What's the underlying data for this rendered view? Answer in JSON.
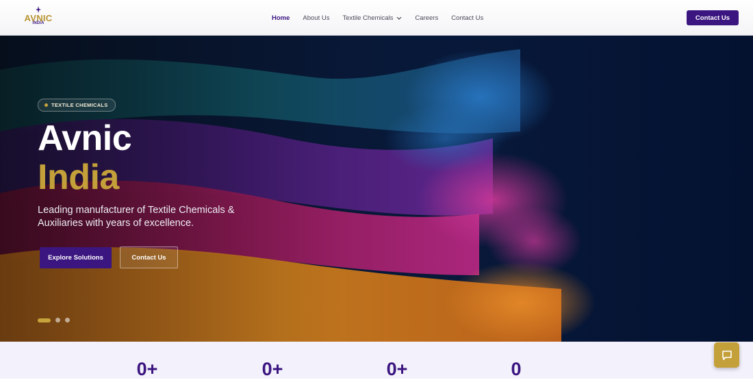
{
  "brand": {
    "logo_main": "AVNIC",
    "logo_sub": "INDIA",
    "colors": {
      "primary": "#3b1580",
      "gold": "#c4a03a"
    }
  },
  "nav": {
    "items": [
      {
        "label": "Home",
        "active": true
      },
      {
        "label": "About Us"
      },
      {
        "label": "Textile Chemicals",
        "has_dropdown": true
      },
      {
        "label": "Careers"
      },
      {
        "label": "Contact Us"
      }
    ],
    "cta_label": "Contact Us"
  },
  "hero": {
    "badge": "TEXTILE CHEMICALS",
    "title_line1": "Avnic",
    "title_line2": "India",
    "description": "Leading manufacturer of Textile Chemicals & Auxiliaries with years of excellence.",
    "primary_button": "Explore Solutions",
    "secondary_button": "Contact Us",
    "slides": {
      "count": 3,
      "active": 1
    }
  },
  "stats": {
    "values": [
      "0+",
      "0+",
      "0+",
      "0"
    ]
  },
  "chat": {
    "icon": "chat-bubble-icon"
  }
}
